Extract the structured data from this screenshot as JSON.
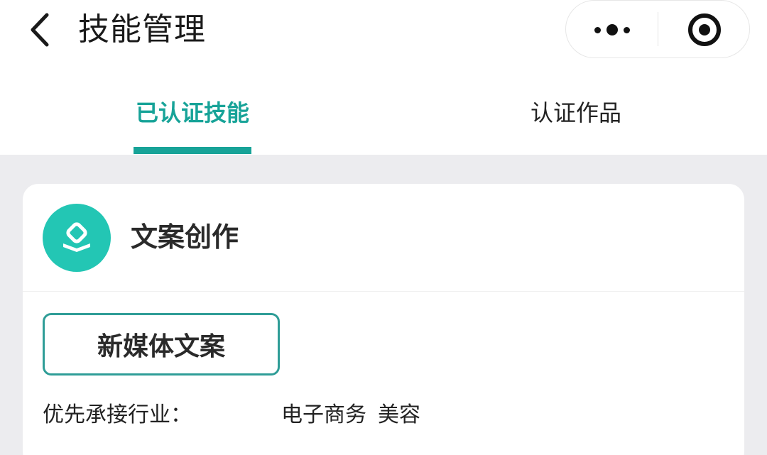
{
  "header": {
    "title": "技能管理",
    "back_icon": "chevron-left-icon",
    "more_icon": "more-dots-icon",
    "close_icon": "target-close-icon"
  },
  "tabs": [
    {
      "label": "已认证技能",
      "active": true
    },
    {
      "label": "认证作品",
      "active": false
    }
  ],
  "colors": {
    "accent": "#17a398",
    "icon_bg": "#23c6b4",
    "page_bg": "#ececef",
    "tag_border": "#2f9d97"
  },
  "skill_card": {
    "icon": "skill-badge-icon",
    "name": "文案创作",
    "tags": [
      "新媒体文案"
    ],
    "industry_label": "优先承接行业：",
    "industries": [
      "电子商务",
      "美容"
    ]
  }
}
